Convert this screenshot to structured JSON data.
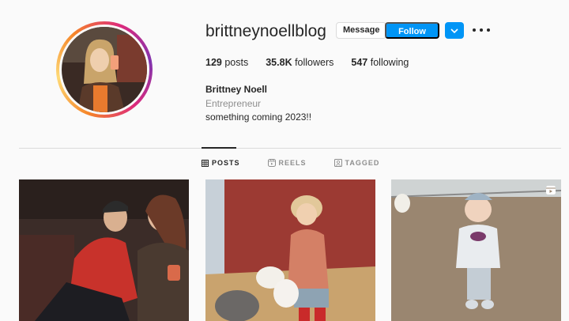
{
  "profile": {
    "username": "brittneynoellblog",
    "full_name": "Brittney Noell",
    "category": "Entrepreneur",
    "bio": "something coming 2023!!",
    "avatar_icon": "profile-photo"
  },
  "actions": {
    "message_label": "Message",
    "follow_label": "Follow",
    "dropdown_icon": "chevron-down-icon",
    "more_icon": "more-options-icon"
  },
  "stats": {
    "posts_count": "129",
    "posts_label": "posts",
    "followers_count": "35.8K",
    "followers_label": "followers",
    "following_count": "547",
    "following_label": "following"
  },
  "tabs": [
    {
      "label": "POSTS",
      "icon": "grid-icon",
      "active": true
    },
    {
      "label": "REELS",
      "icon": "reels-icon",
      "active": false
    },
    {
      "label": "TAGGED",
      "icon": "tagged-icon",
      "active": false
    }
  ],
  "posts": [
    {
      "type": "photo",
      "icon": "post-photo"
    },
    {
      "type": "photo",
      "icon": "post-photo"
    },
    {
      "type": "reel",
      "icon": "reel-badge-icon"
    }
  ],
  "colors": {
    "accent": "#0095f6",
    "background": "#fafafa",
    "text": "#262626",
    "muted": "#8e8e8e"
  }
}
